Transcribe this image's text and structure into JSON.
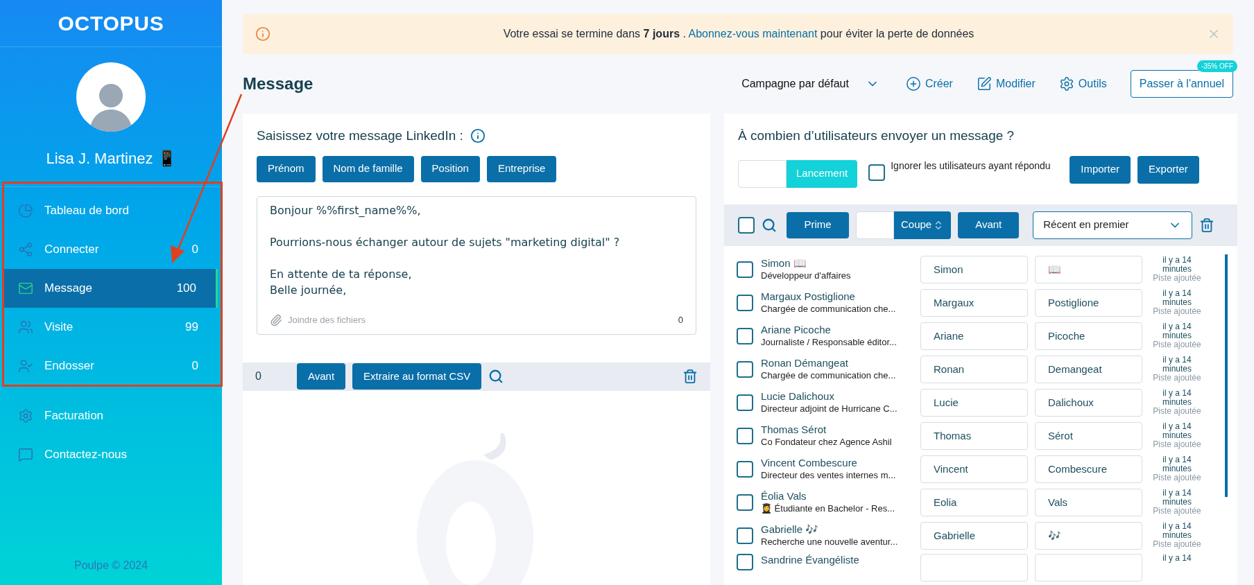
{
  "sidebar": {
    "logo": "OCTOPUS",
    "user_name": "Lisa J. Martinez 📱",
    "nav_items": [
      {
        "label": "Tableau de bord",
        "selected": false
      },
      {
        "label": "Connecter",
        "count": "0",
        "selected": false
      },
      {
        "label": "Message",
        "count": "100",
        "selected": true
      },
      {
        "label": "Visite",
        "count": "99",
        "selected": false
      },
      {
        "label": "Endosser",
        "count": "0",
        "selected": false
      }
    ],
    "secondary_items": [
      {
        "label": "Facturation"
      },
      {
        "label": "Contactez-nous"
      }
    ],
    "footer": "Poulpe © 2024"
  },
  "banner": {
    "text": "Votre essai se termine dans **7 jours** .",
    "link": "Abonnez-vous maintenant",
    "text_after": "pour éviter la perte de données"
  },
  "header": {
    "title": "Message",
    "campaign": "Campagne par défaut",
    "actions": [
      "Créer",
      "Modifier",
      "Outils"
    ],
    "upgrade_button": "Passer à l'annuel",
    "discount_badge": "-35% OFF"
  },
  "composer": {
    "prompt": "Saisissez votre message LinkedIn :",
    "tags": [
      "Prénom",
      "Nom de famille",
      "Position",
      "Entreprise"
    ],
    "message": "Bonjour %%first_name%%,\n\nPourrions-nous échanger autour de sujets \"marketing digital\" ?\n\nEn attente de ta réponse,\nBelle journée,",
    "attach": "Joindre des fichiers",
    "char_count": "0",
    "toolbar": {
      "count": "0",
      "buttons": [
        "Avant",
        "Extraire au format CSV"
      ]
    }
  },
  "recipients": {
    "question": "À combien d’utilisateurs envoyer un message ?",
    "launch_button": "Lancement",
    "ignore_replied": {
      "label": "Ignorer les utilisateurs ayant répondu",
      "checked": false
    },
    "buttons": [
      "Importer",
      "Exporter"
    ],
    "toolbar": {
      "select_all": false,
      "prime_button": "Prime",
      "cut_select": "Coupe",
      "forward_button": "Avant",
      "sort": "Récent en premier"
    },
    "rows": [
      {
        "name": "Simon 📖",
        "title": "Développeur d'affaires",
        "first": "Simon",
        "last": "📖",
        "time": "il y a 14 minutes",
        "status": "Piste ajoutée",
        "checked": false
      },
      {
        "name": "Margaux Postiglione",
        "title": "Chargée de communication che...",
        "first": "Margaux",
        "last": "Postiglione",
        "time": "il y a 14 minutes",
        "status": "Piste ajoutée",
        "checked": false
      },
      {
        "name": "Ariane Picoche",
        "title": "Journaliste / Responsable éditor...",
        "first": "Ariane",
        "last": "Picoche",
        "time": "il y a 14 minutes",
        "status": "Piste ajoutée",
        "checked": false
      },
      {
        "name": "Ronan Démangeat",
        "title": "Chargée de communication che...",
        "first": "Ronan",
        "last": "Demangeat",
        "time": "il y a 14 minutes",
        "status": "Piste ajoutée",
        "checked": false
      },
      {
        "name": "Lucie Dalichoux",
        "title": "Directeur adjoint de Hurricane C...",
        "first": "Lucie",
        "last": "Dalichoux",
        "time": "il y a 14 minutes",
        "status": "Piste ajoutée",
        "checked": false
      },
      {
        "name": "Thomas Sérot",
        "title": "Co Fondateur chez Agence Ashil",
        "first": "Thomas",
        "last": "Sérot",
        "time": "il y a 14 minutes",
        "status": "Piste ajoutée",
        "checked": false
      },
      {
        "name": "Vincent Combescure",
        "title": "Directeur des ventes internes m...",
        "first": "Vincent",
        "last": "Combescure",
        "time": "il y a 14 minutes",
        "status": "Piste ajoutée",
        "checked": false
      },
      {
        "name": "Éolia Vals",
        "title": "👩‍🎓 Étudiante en Bachelor - Res...",
        "first": "Eolia",
        "last": "Vals",
        "time": "il y a 14 minutes",
        "status": "Piste ajoutée",
        "checked": false
      },
      {
        "name": "Gabrielle 🎶",
        "title": "Recherche une nouvelle aventur...",
        "first": "Gabrielle",
        "last": "🎶",
        "time": "il y a 14 minutes",
        "status": "Piste ajoutée",
        "checked": false
      },
      {
        "name": "Sandrine Évangéliste",
        "time": "il y a 14",
        "checked": false
      }
    ]
  }
}
